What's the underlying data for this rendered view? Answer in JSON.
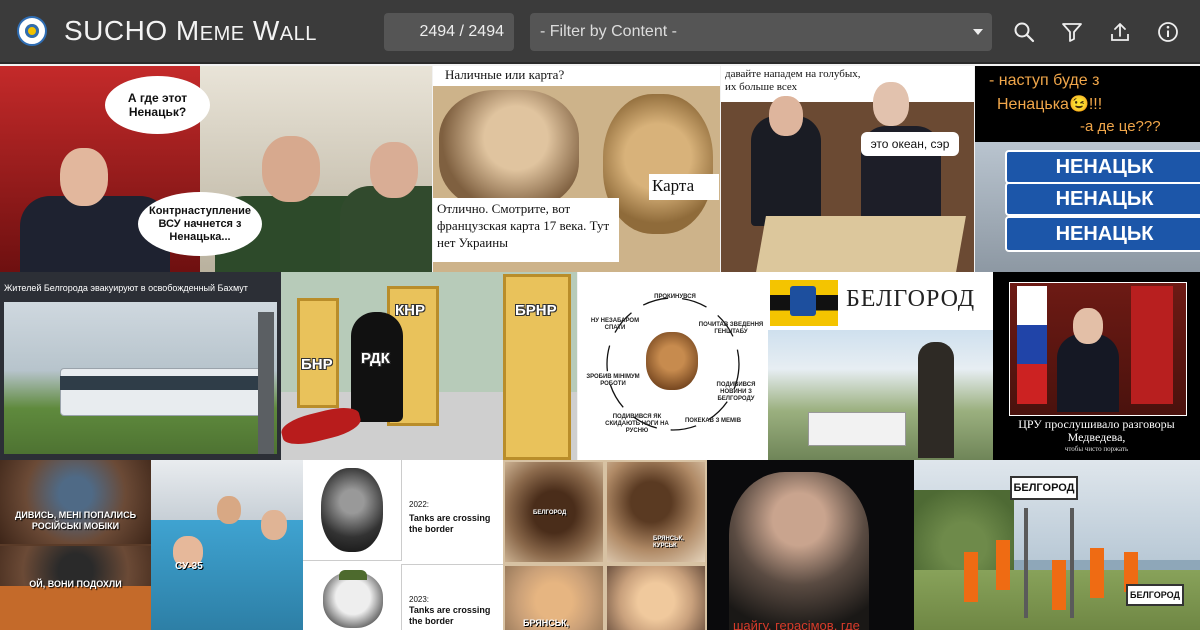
{
  "header": {
    "title_prefix": "SUCHO ",
    "title_small_caps": "Meme Wall",
    "counter": "2494 / 2494",
    "filter_placeholder": "- Filter by Content -",
    "icons": [
      "search-icon",
      "filter-icon",
      "upload-icon",
      "info-icon"
    ]
  },
  "memes": {
    "m1": {
      "bubble_top": "А где этот Ненацьк?",
      "bubble_bottom": "Контрнаступление ВСУ начнется з Ненацька..."
    },
    "m2": {
      "top": "Наличные или карта?",
      "right": "Карта",
      "bottom": "Отлично. Смотрите, вот французская карта 17 века. Тут нет Украины"
    },
    "m3": {
      "top": "давайте нападем на голубых, их больше всех",
      "bubble": "это океан, сэр"
    },
    "m4": {
      "line1": "- наступ буде з",
      "line2": "Ненацька😉!!!",
      "line3": "-а де це???",
      "sign1": "НЕНАЦЬК",
      "sign2": "НЕНАЦЬК",
      "sign3": "НЕНАЦЬК"
    },
    "m5": {
      "caption": "Жителей Белгорода эвакуируют в освобожденный Бахмут"
    },
    "m6": {
      "door1": "БНР",
      "door2": "КНР",
      "reaper": "РДК",
      "door3": "БРНР"
    },
    "m7": {
      "steps": [
        "ПРОКИНУВСЯ",
        "ПОЧИТАВ ЗВЕДЕННЯ ГЕНШТАБУ",
        "ПОДИВИВСЯ НОВИНИ З БЕЛГОРОДУ",
        "ПОКЕКАВ З МЕМІВ",
        "ПОДИВИВСЯ ЯК СКИДАЮТЬ НОГИ НА РУСНЮ",
        "ЗРОБИВ МІНІМУМ РОБОТИ",
        "НУ НЕЗАБАРОМ СПАТИ"
      ]
    },
    "m8": {
      "title": "БЕЛГОРОД"
    },
    "m9": {
      "caption": "ЦРУ прослушивало разговоры Медведева,",
      "small": "чтобы чисто поржать"
    },
    "m10": {
      "top": "ДИВИСЬ, МЕНІ ПОПАЛИСЬ РОСІЙСЬКІ МОБІКИ",
      "bottom": "ОЙ, ВОНИ ПОДОХЛИ"
    },
    "m11": {
      "label": "СУ-35"
    },
    "m12": {
      "year1": "2022:",
      "text1": "Tanks are crossing the border",
      "year2": "2023:",
      "text2": "Tanks are crossing the border"
    },
    "m13": {
      "label1": "БЕЛГОРОД",
      "label2": "БРЯНСЬК, КУРСЬК",
      "label3": "БРЯНСЬК,"
    },
    "m14": {
      "caption": "шайгу, герасімов, где"
    },
    "m15": {
      "sign1": "БЕЛГОРОД",
      "sign2": "БЕЛГОРОД"
    }
  }
}
